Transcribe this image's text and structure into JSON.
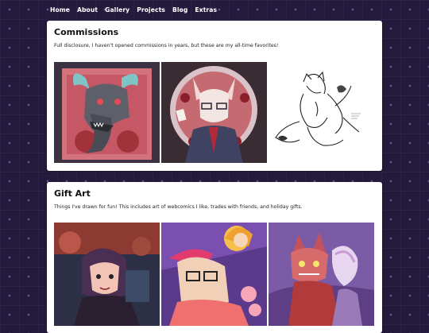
{
  "nav": {
    "items": [
      "Home",
      "About",
      "Gallery",
      "Projects",
      "Blog",
      "Extras"
    ]
  },
  "commissions": {
    "title": "Commissions",
    "description": "Full disclosure, I haven't opened commissions in years, but these are my all-time favorites!"
  },
  "gift_art": {
    "title": "Gift Art",
    "description": "Things I've drawn for fun! This includes art of webcomics I like, trades with friends, and holiday gifts."
  },
  "colors": {
    "page_bg": "#241a3c",
    "panel_bg": "#ffffff",
    "nav_text": "#ffffff"
  }
}
